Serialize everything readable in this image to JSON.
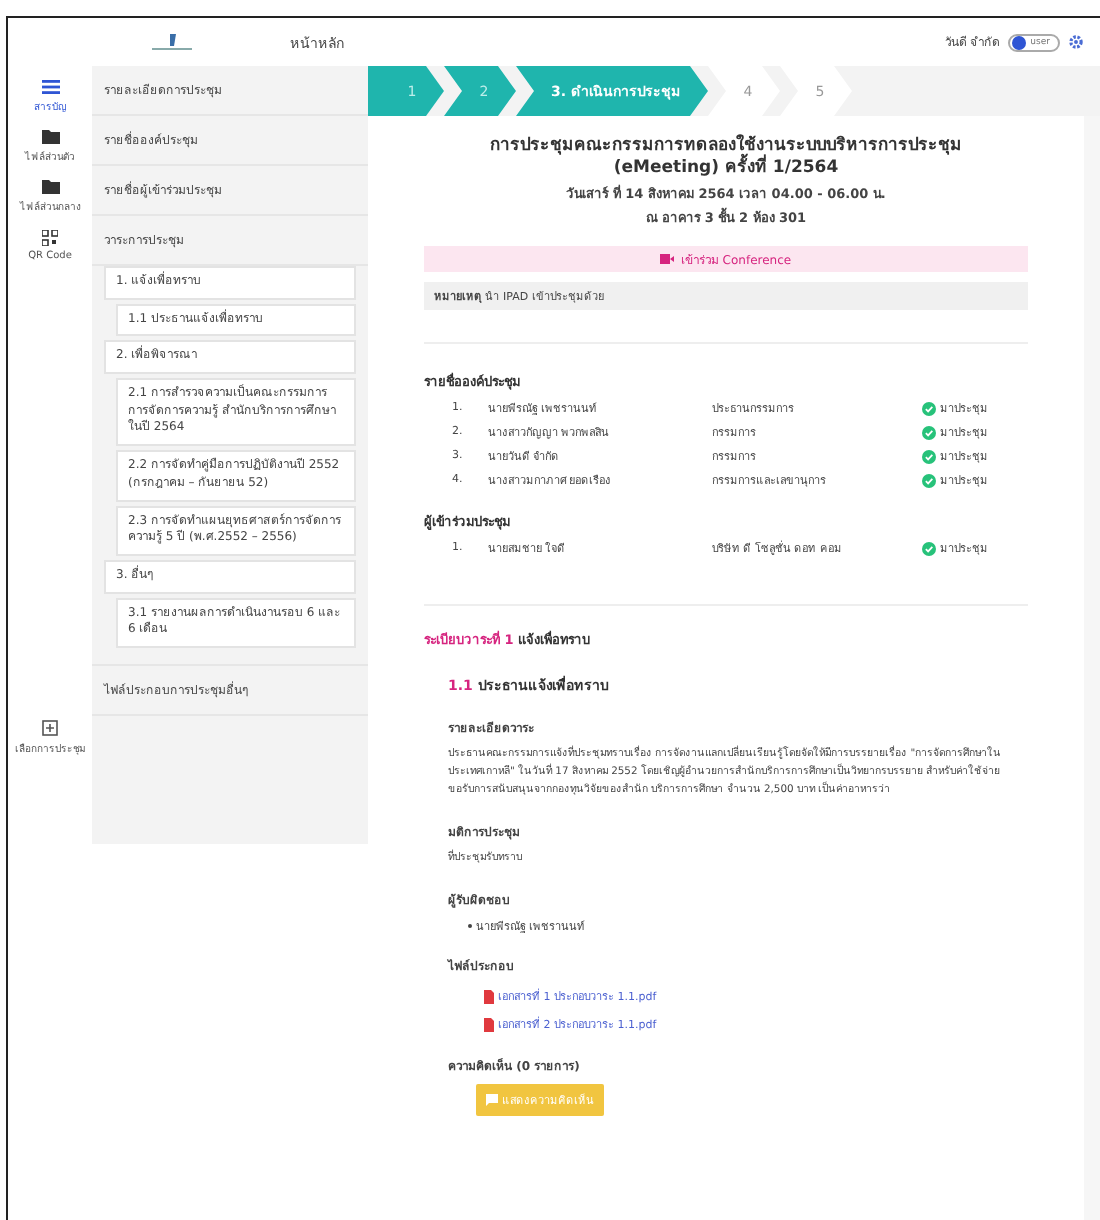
{
  "header": {
    "title": "หน้าหลัก",
    "user": "วันดี จำกัด",
    "role_toggle": {
      "label": "user",
      "on": true
    }
  },
  "nav": [
    {
      "label": "สารบัญ",
      "kind": "list",
      "selected": true
    },
    {
      "label": "ไฟล์ส่วนตัว",
      "kind": "folder",
      "selected": false
    },
    {
      "label": "ไฟล์ส่วนกลาง",
      "kind": "folder",
      "selected": false
    },
    {
      "label": "QR Code",
      "kind": "qr",
      "selected": false
    }
  ],
  "nav_bottom": {
    "label": "เลือกการประชุม"
  },
  "sidebar": {
    "items": [
      {
        "label": "รายละเอียดการประชุม"
      },
      {
        "label": "รายชื่อองค์ประชุม"
      },
      {
        "label": "รายชื่อผู้เข้าร่วมประชุม"
      },
      {
        "label": "วาระการประชุม"
      }
    ],
    "agenda": [
      {
        "label": "1. แจ้งเพื่อทราบ",
        "children": [
          {
            "label": "1.1 ประธานแจ้งเพื่อทราบ"
          }
        ]
      },
      {
        "label": "2. เพื่อพิจารณา",
        "children": [
          {
            "label": "2.1 การสำรวจความเป็นคณะกรรมการการจัดการความรู้ สำนักบริการการศึกษา ในปี 2564"
          },
          {
            "label": "2.2 การจัดทำคู่มือการปฏิบัติงานปี 2552 (กรกฎาคม – กันยายน 52)"
          },
          {
            "label": "2.3 การจัดทำแผนยุทธศาสตร์การจัดการความรู้ 5 ปี (พ.ศ.2552 – 2556)"
          }
        ]
      },
      {
        "label": "3. อื่นๆ",
        "children": [
          {
            "label": "3.1 รายงานผลการดำเนินงานรอบ 6 และ 6 เดือน"
          }
        ]
      }
    ],
    "footer_item": {
      "label": "ไฟล์ประกอบการประชุมอื่นๆ"
    }
  },
  "steps": [
    {
      "label": "1",
      "done": true,
      "selected": false
    },
    {
      "label": "2",
      "done": true,
      "selected": false
    },
    {
      "label": "3. ดำเนินการประชุม",
      "done": false,
      "selected": true
    },
    {
      "label": "4",
      "done": false,
      "selected": false
    },
    {
      "label": "5",
      "done": false,
      "selected": false
    }
  ],
  "meeting": {
    "title": "การประชุมคณะกรรมการทดลองใช้งานระบบบริหารการประชุม (eMeeting) ครั้งที่ 1/2564",
    "date": "วันเสาร์ ที่ 14 สิงหาคม 2564 เวลา 04.00 - 06.00 น.",
    "place": "ณ อาคาร 3 ชั้น 2 ห้อง 301",
    "conference_button": "เข้าร่วม Conference",
    "note": "**หมายเหตุ** นำ IPAD เข้าประชุมด้วย"
  },
  "quorum": {
    "heading": "รายชื่อองค์ประชุม",
    "rows": [
      {
        "no": "1.",
        "name": "นายพีรณัฐ เพชรานนท์",
        "role": "ประธานกรรมการ",
        "status": "มาประชุม",
        "present": true
      },
      {
        "no": "2.",
        "name": "นางสาวกัญญา พวกพลสิน",
        "role": "กรรมการ",
        "status": "มาประชุม",
        "present": true
      },
      {
        "no": "3.",
        "name": "นายวันดี จำกัด",
        "role": "กรรมการ",
        "status": "มาประชุม",
        "present": true
      },
      {
        "no": "4.",
        "name": "นางสาวมกาภาศ ยอดเรือง",
        "role": "กรรมการและเลขานุการ",
        "status": "มาประชุม",
        "present": true
      }
    ]
  },
  "participants": {
    "heading": "ผู้เข้าร่วมประชุม",
    "rows": [
      {
        "no": "1.",
        "name": "นายสมชาย ใจดี",
        "role": "บริษัท ดี โซลูชั่น ดอท คอม",
        "status": "มาประชุม",
        "present": true
      }
    ]
  },
  "agenda_detail": {
    "section_no": "ระเบียบวาระที่ 1",
    "section_title": "แจ้งเพื่อทราบ",
    "item_no": "1.1",
    "item_title": "ประธานแจ้งเพื่อทราบ",
    "detail_heading": "รายละเอียดวาระ",
    "detail_text": "ประธานคณะกรรมการแจ้งที่ประชุมทราบเรื่อง การจัดงานแลกเปลี่ยนเรียนรู้โดยจัดให้มีการบรรยายเรื่อง \"การจัดการศึกษาในประเทศเกาหลี\" ในวันที่ 17 สิงหาคม 2552 โดยเชิญผู้อำนวยการสำนักบริการการศึกษาเป็นวิทยากรบรรยาย สำหรับค่าใช้จ่าย ขอรับการสนับสนุนจากกองทุนวิจัยของสำนัก บริการการศึกษา จำนวน 2,500 บาท เป็นค่าอาหารว่า",
    "resolution_heading": "มติการประชุม",
    "resolution": "ที่ประชุมรับทราบ",
    "owner_heading": "ผู้รับผิดชอบ",
    "owners": [
      "นายพีรณัฐ เพชรานนท์"
    ],
    "files_heading": "ไฟล์ประกอบ",
    "files": [
      "เอกสารที่ 1 ประกอบวาระ 1.1.pdf",
      "เอกสารที่ 2 ประกอบวาระ 1.1.pdf"
    ],
    "comments_heading": "ความคิดเห็น (0 รายการ)",
    "comment_button": "แสดงความคิดเห็น"
  }
}
